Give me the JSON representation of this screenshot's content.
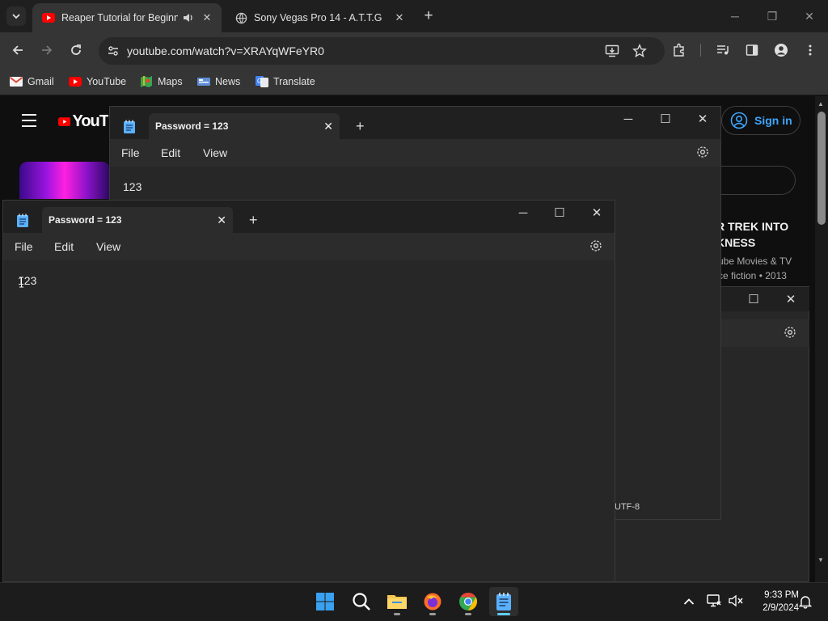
{
  "browser": {
    "tabs": [
      {
        "title": "Reaper Tutorial for Beginne",
        "active": true,
        "favicon": "youtube-icon",
        "audio": true
      },
      {
        "title": "Sony Vegas Pro 14 - A.T.T.G",
        "active": false,
        "favicon": "globe-icon"
      }
    ],
    "url": "youtube.com/watch?v=XRAYqWFeYR0",
    "bookmarks": [
      {
        "label": "Gmail",
        "icon": "gmail-icon"
      },
      {
        "label": "YouTube",
        "icon": "youtube-icon"
      },
      {
        "label": "Maps",
        "icon": "maps-icon"
      },
      {
        "label": "News",
        "icon": "news-icon"
      },
      {
        "label": "Translate",
        "icon": "translate-icon"
      }
    ]
  },
  "youtube": {
    "logo_partial": "YouT",
    "sign_in": "Sign in",
    "video_title_line1": "R TREK INTO",
    "video_title_line2": "KNESS",
    "video_meta_line1": "ube Movies & TV",
    "video_meta_line2": "ce fiction • 2013"
  },
  "notepad_back": {
    "tab_title": "Password = 123",
    "menu": [
      "File",
      "Edit",
      "View"
    ],
    "content": "123",
    "encoding": "UTF-8"
  },
  "notepad_front": {
    "tab_title": "Password = 123",
    "menu": [
      "File",
      "Edit",
      "View"
    ],
    "content": "123"
  },
  "taskbar": {
    "time": "9:33 PM",
    "date": "2/9/2024"
  },
  "colors": {
    "youtube_red": "#ff0000",
    "accent_blue": "#3ea6ff",
    "taskbar_active": "#60cdff"
  }
}
